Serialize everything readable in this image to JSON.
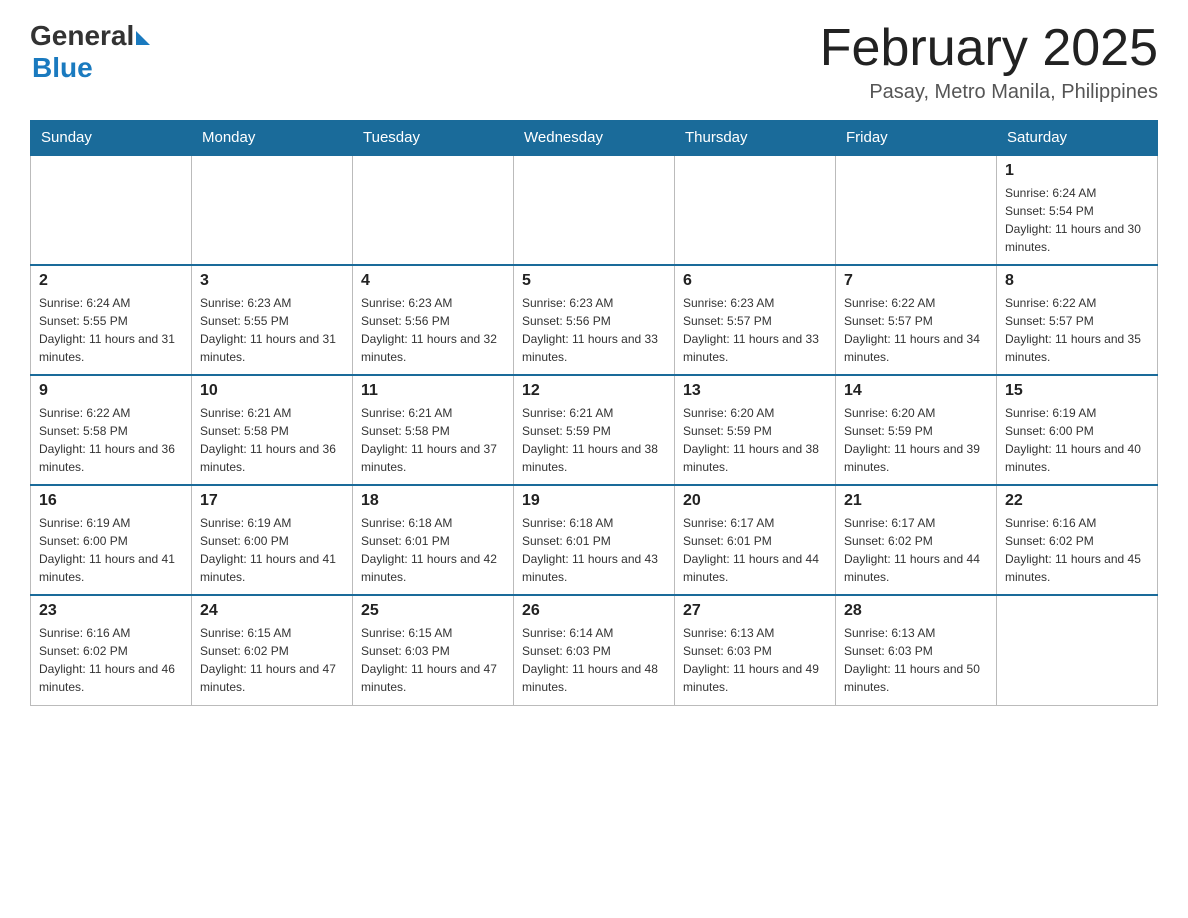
{
  "header": {
    "logo_general": "General",
    "logo_blue": "Blue",
    "title": "February 2025",
    "subtitle": "Pasay, Metro Manila, Philippines"
  },
  "calendar": {
    "days_of_week": [
      "Sunday",
      "Monday",
      "Tuesday",
      "Wednesday",
      "Thursday",
      "Friday",
      "Saturday"
    ],
    "weeks": [
      [
        {
          "day": "",
          "empty": true
        },
        {
          "day": "",
          "empty": true
        },
        {
          "day": "",
          "empty": true
        },
        {
          "day": "",
          "empty": true
        },
        {
          "day": "",
          "empty": true
        },
        {
          "day": "",
          "empty": true
        },
        {
          "day": "1",
          "sunrise": "6:24 AM",
          "sunset": "5:54 PM",
          "daylight": "11 hours and 30 minutes."
        }
      ],
      [
        {
          "day": "2",
          "sunrise": "6:24 AM",
          "sunset": "5:55 PM",
          "daylight": "11 hours and 31 minutes."
        },
        {
          "day": "3",
          "sunrise": "6:23 AM",
          "sunset": "5:55 PM",
          "daylight": "11 hours and 31 minutes."
        },
        {
          "day": "4",
          "sunrise": "6:23 AM",
          "sunset": "5:56 PM",
          "daylight": "11 hours and 32 minutes."
        },
        {
          "day": "5",
          "sunrise": "6:23 AM",
          "sunset": "5:56 PM",
          "daylight": "11 hours and 33 minutes."
        },
        {
          "day": "6",
          "sunrise": "6:23 AM",
          "sunset": "5:57 PM",
          "daylight": "11 hours and 33 minutes."
        },
        {
          "day": "7",
          "sunrise": "6:22 AM",
          "sunset": "5:57 PM",
          "daylight": "11 hours and 34 minutes."
        },
        {
          "day": "8",
          "sunrise": "6:22 AM",
          "sunset": "5:57 PM",
          "daylight": "11 hours and 35 minutes."
        }
      ],
      [
        {
          "day": "9",
          "sunrise": "6:22 AM",
          "sunset": "5:58 PM",
          "daylight": "11 hours and 36 minutes."
        },
        {
          "day": "10",
          "sunrise": "6:21 AM",
          "sunset": "5:58 PM",
          "daylight": "11 hours and 36 minutes."
        },
        {
          "day": "11",
          "sunrise": "6:21 AM",
          "sunset": "5:58 PM",
          "daylight": "11 hours and 37 minutes."
        },
        {
          "day": "12",
          "sunrise": "6:21 AM",
          "sunset": "5:59 PM",
          "daylight": "11 hours and 38 minutes."
        },
        {
          "day": "13",
          "sunrise": "6:20 AM",
          "sunset": "5:59 PM",
          "daylight": "11 hours and 38 minutes."
        },
        {
          "day": "14",
          "sunrise": "6:20 AM",
          "sunset": "5:59 PM",
          "daylight": "11 hours and 39 minutes."
        },
        {
          "day": "15",
          "sunrise": "6:19 AM",
          "sunset": "6:00 PM",
          "daylight": "11 hours and 40 minutes."
        }
      ],
      [
        {
          "day": "16",
          "sunrise": "6:19 AM",
          "sunset": "6:00 PM",
          "daylight": "11 hours and 41 minutes."
        },
        {
          "day": "17",
          "sunrise": "6:19 AM",
          "sunset": "6:00 PM",
          "daylight": "11 hours and 41 minutes."
        },
        {
          "day": "18",
          "sunrise": "6:18 AM",
          "sunset": "6:01 PM",
          "daylight": "11 hours and 42 minutes."
        },
        {
          "day": "19",
          "sunrise": "6:18 AM",
          "sunset": "6:01 PM",
          "daylight": "11 hours and 43 minutes."
        },
        {
          "day": "20",
          "sunrise": "6:17 AM",
          "sunset": "6:01 PM",
          "daylight": "11 hours and 44 minutes."
        },
        {
          "day": "21",
          "sunrise": "6:17 AM",
          "sunset": "6:02 PM",
          "daylight": "11 hours and 44 minutes."
        },
        {
          "day": "22",
          "sunrise": "6:16 AM",
          "sunset": "6:02 PM",
          "daylight": "11 hours and 45 minutes."
        }
      ],
      [
        {
          "day": "23",
          "sunrise": "6:16 AM",
          "sunset": "6:02 PM",
          "daylight": "11 hours and 46 minutes."
        },
        {
          "day": "24",
          "sunrise": "6:15 AM",
          "sunset": "6:02 PM",
          "daylight": "11 hours and 47 minutes."
        },
        {
          "day": "25",
          "sunrise": "6:15 AM",
          "sunset": "6:03 PM",
          "daylight": "11 hours and 47 minutes."
        },
        {
          "day": "26",
          "sunrise": "6:14 AM",
          "sunset": "6:03 PM",
          "daylight": "11 hours and 48 minutes."
        },
        {
          "day": "27",
          "sunrise": "6:13 AM",
          "sunset": "6:03 PM",
          "daylight": "11 hours and 49 minutes."
        },
        {
          "day": "28",
          "sunrise": "6:13 AM",
          "sunset": "6:03 PM",
          "daylight": "11 hours and 50 minutes."
        },
        {
          "day": "",
          "empty": true
        }
      ]
    ]
  }
}
